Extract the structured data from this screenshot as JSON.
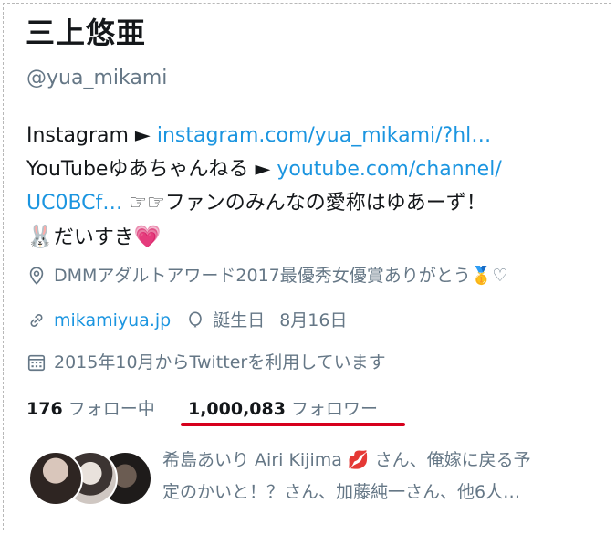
{
  "profile": {
    "name": "三上悠亜",
    "handle": "@yua_mikami"
  },
  "bio": {
    "line1_prefix": "Instagram ►",
    "link1": "instagram.com/yua_mikami/?hl…",
    "line2_prefix": "YouTubeゆあちゃんねる ►",
    "link2a": "youtube.com/channel/",
    "link2b": "UC0BCf…",
    "hands": "☞☞",
    "line3_text": "ファンのみんなの愛称はゆあーず！",
    "rabbit": "🐰",
    "line4_text": "だいすき",
    "heart": "💗"
  },
  "meta": {
    "location": "DMMアダルトアワード2017最優秀女優賞ありがとう",
    "location_medal": "🥇",
    "location_heart": "♡",
    "url": "mikamiyua.jp",
    "birthday_label": "誕生日",
    "birthday_value": "8月16日",
    "joined": "2015年10月からTwitterを利用しています"
  },
  "stats": {
    "following_count": "176",
    "following_label": "フォロー中",
    "followers_count": "1,000,083",
    "followers_label": "フォロワー"
  },
  "followed_by": {
    "line1": "希島あいり Airi Kijima 💋 さん、俺嫁に戻る予",
    "line2": "定のかいと！？さん、加藤純一さん、他6人…"
  },
  "colors": {
    "link": "#1b95e0",
    "muted": "#657786",
    "text": "#14171a",
    "annotation_underline": "#d6001c"
  }
}
